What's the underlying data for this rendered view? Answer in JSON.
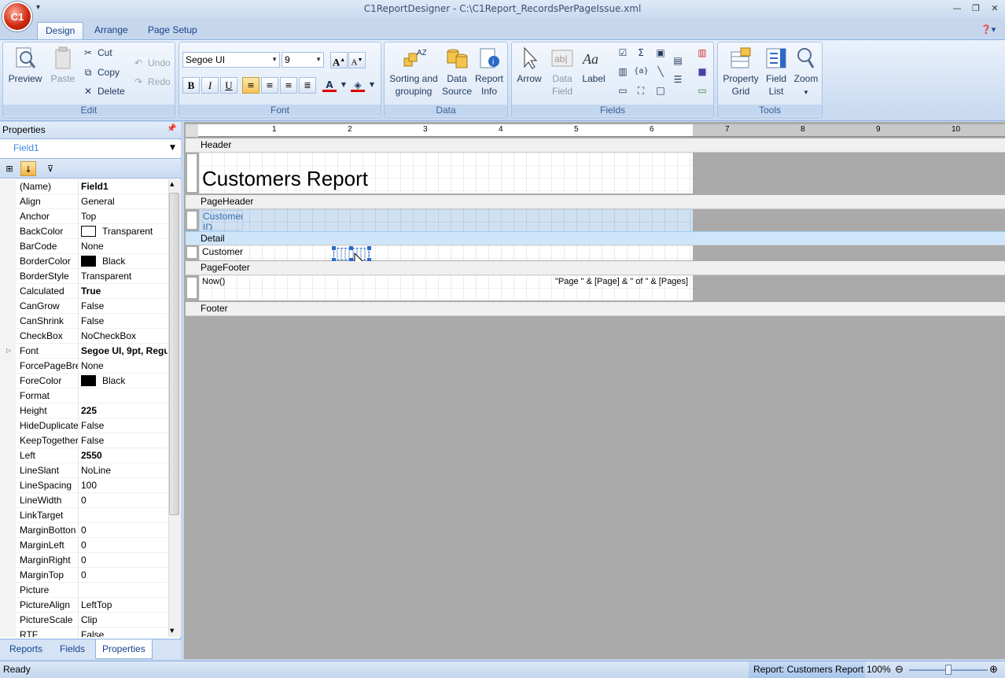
{
  "window": {
    "title": "C1ReportDesigner - C:\\C1Report_RecordsPerPageIssue.xml",
    "orb": "C1"
  },
  "tabs": [
    "Design",
    "Arrange",
    "Page Setup"
  ],
  "ribbon": {
    "edit": {
      "label": "Edit",
      "preview": "Preview",
      "paste": "Paste",
      "cut": "Cut",
      "copy": "Copy",
      "delete": "Delete",
      "undo": "Undo",
      "redo": "Redo"
    },
    "font": {
      "label": "Font",
      "family": "Segoe UI",
      "size": "9",
      "bold": "B",
      "italic": "I",
      "underline": "U"
    },
    "data": {
      "label": "Data",
      "sorting_line1": "Sorting and",
      "sorting_line2": "grouping",
      "source_line1": "Data",
      "source_line2": "Source",
      "info_line1": "Report",
      "info_line2": "Info"
    },
    "fields": {
      "label": "Fields",
      "arrow": "Arrow",
      "datafield_line1": "Data",
      "datafield_line2": "Field",
      "labelbtn": "Label"
    },
    "tools": {
      "label": "Tools",
      "grid_line1": "Property",
      "grid_line2": "Grid",
      "list_line1": "Field",
      "list_line2": "List",
      "zoom": "Zoom"
    }
  },
  "properties": {
    "header": "Properties",
    "object": "Field1",
    "rows": [
      {
        "name": "(Name)",
        "value": "Field1",
        "bold": true
      },
      {
        "name": "Align",
        "value": "General"
      },
      {
        "name": "Anchor",
        "value": "Top"
      },
      {
        "name": "BackColor",
        "value": "Transparent",
        "swatch": "#ffffff"
      },
      {
        "name": "BarCode",
        "value": "None"
      },
      {
        "name": "BorderColor",
        "value": "Black",
        "swatch": "#000000"
      },
      {
        "name": "BorderStyle",
        "value": "Transparent"
      },
      {
        "name": "Calculated",
        "value": "True",
        "bold": true
      },
      {
        "name": "CanGrow",
        "value": "False"
      },
      {
        "name": "CanShrink",
        "value": "False"
      },
      {
        "name": "CheckBox",
        "value": "NoCheckBox"
      },
      {
        "name": "Font",
        "value": "Segoe UI, 9pt, Regu",
        "bold": true,
        "expand": true
      },
      {
        "name": "ForcePageBre",
        "value": "None"
      },
      {
        "name": "ForeColor",
        "value": "Black",
        "swatch": "#000000"
      },
      {
        "name": "Format",
        "value": ""
      },
      {
        "name": "Height",
        "value": "225",
        "bold": true
      },
      {
        "name": "HideDuplicate",
        "value": "False"
      },
      {
        "name": "KeepTogether",
        "value": "False"
      },
      {
        "name": "Left",
        "value": "2550",
        "bold": true
      },
      {
        "name": "LineSlant",
        "value": "NoLine"
      },
      {
        "name": "LineSpacing",
        "value": "100"
      },
      {
        "name": "LineWidth",
        "value": "0"
      },
      {
        "name": "LinkTarget",
        "value": ""
      },
      {
        "name": "MarginBotton",
        "value": "0"
      },
      {
        "name": "MarginLeft",
        "value": "0"
      },
      {
        "name": "MarginRight",
        "value": "0"
      },
      {
        "name": "MarginTop",
        "value": "0"
      },
      {
        "name": "Picture",
        "value": ""
      },
      {
        "name": "PictureAlign",
        "value": "LeftTop"
      },
      {
        "name": "PictureScale",
        "value": "Clip"
      },
      {
        "name": "RTF",
        "value": "False"
      }
    ]
  },
  "bottom_tabs": [
    "Reports",
    "Fields",
    "Properties"
  ],
  "ruler": [
    "1",
    "2",
    "3",
    "4",
    "5",
    "6",
    "7",
    "8",
    "9",
    "10"
  ],
  "report": {
    "sections": [
      "Header",
      "PageHeader",
      "Detail",
      "PageFooter",
      "Footer"
    ],
    "title": "Customers Report",
    "customer_id": "Customer ID",
    "customer": "Customer",
    "now": "Now()",
    "pages": "\"Page \" & [Page] & \" of \" & [Pages]"
  },
  "status": {
    "left": "Ready",
    "report": "Report: Customers Report",
    "zoom": "100%"
  }
}
